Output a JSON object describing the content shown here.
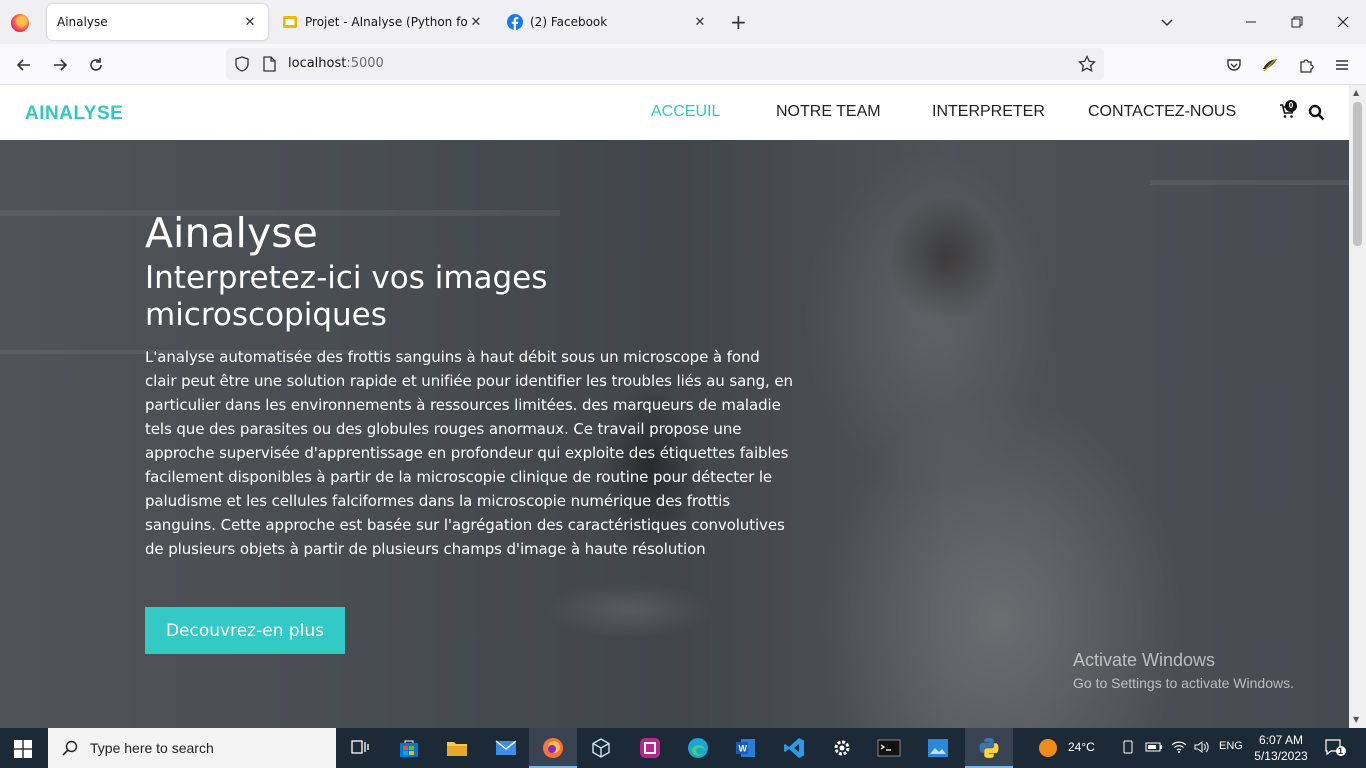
{
  "browser": {
    "tabs": [
      {
        "title": "Ainalyse",
        "active": true
      },
      {
        "title": "Projet - AInalyse (Python for IA)",
        "active": false
      },
      {
        "title": "(2) Facebook",
        "active": false
      }
    ],
    "url_host": "localhost",
    "url_port": ":5000"
  },
  "site": {
    "brand": "AINALYSE",
    "menu": [
      "ACCEUIL",
      "NOTRE TEAM",
      "INTERPRETER",
      "CONTACTEZ-NOUS"
    ],
    "cart_count": "0"
  },
  "hero": {
    "title": "Ainalyse",
    "subtitle": "Interpretez-ici vos images microscopiques",
    "description": "L'analyse automatisée des frottis sanguins à haut débit sous un microscope à fond clair peut être une solution rapide et unifiée pour identifier les troubles liés au sang, en particulier dans les environnements à ressources limitées. des marqueurs de maladie tels que des parasites ou des globules rouges anormaux. Ce travail propose une approche supervisée d'apprentissage en profondeur qui exploite des étiquettes faibles facilement disponibles à partir de la microscopie clinique de routine pour détecter le paludisme et les cellules falciformes dans la microscopie numérique des frottis sanguins. Cette approche est basée sur l'agrégation des caractéristiques convolutives de plusieurs objets à partir de plusieurs champs d'image à haute résolution",
    "cta": "Decouvrez-en plus"
  },
  "watermark": {
    "title": "Activate Windows",
    "subtitle": "Go to Settings to activate Windows."
  },
  "taskbar": {
    "search_placeholder": "Type here to search",
    "weather": "24°C",
    "language": "ENG",
    "time": "6:07 AM",
    "date": "5/13/2023",
    "notifications": "1"
  },
  "colors": {
    "accent": "#33c9c4",
    "taskbar": "#1c2a38"
  }
}
